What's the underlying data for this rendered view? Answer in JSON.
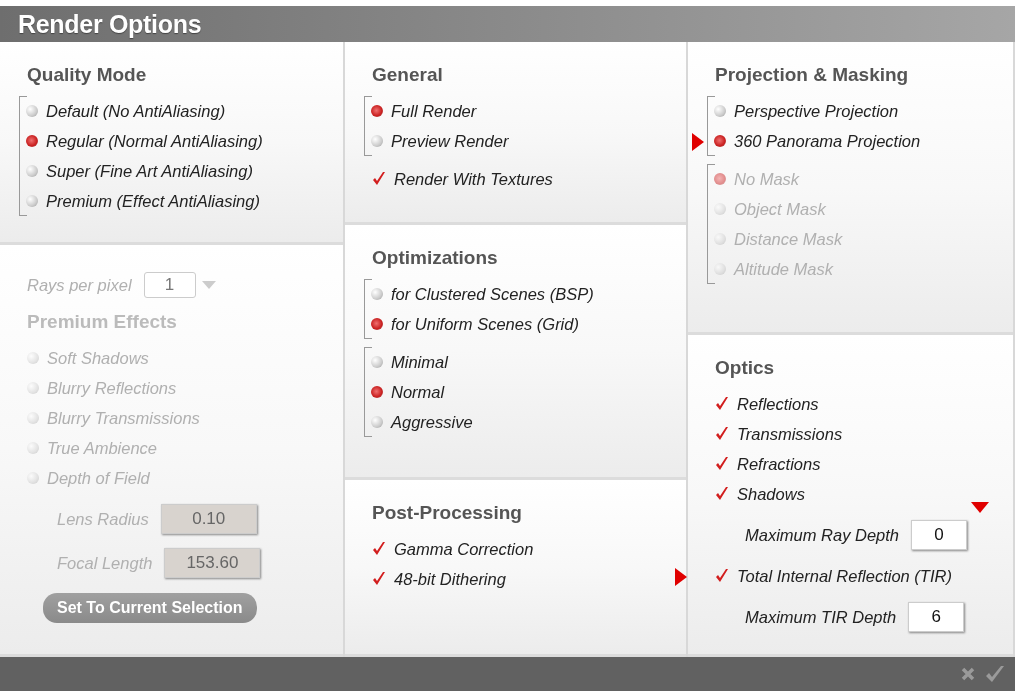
{
  "window": {
    "title": "Render Options"
  },
  "columns": [
    {
      "panels": [
        {
          "title": "Quality Mode",
          "blocks": [
            {
              "kind": "radio_group",
              "items": [
                {
                  "label": "Default (No AntiAliasing)",
                  "selected": false
                },
                {
                  "label": "Regular (Normal AntiAliasing)",
                  "selected": true
                },
                {
                  "label": "Super (Fine Art AntiAliasing)",
                  "selected": false
                },
                {
                  "label": "Premium (Effect AntiAliasing)",
                  "selected": false
                }
              ]
            }
          ]
        },
        {
          "disabled": true,
          "blocks": [
            {
              "kind": "dropdown",
              "label": "Rays per pixel",
              "value": "1"
            },
            {
              "kind": "heading",
              "label": "Premium Effects"
            },
            {
              "kind": "checks",
              "items": [
                {
                  "label": "Soft Shadows",
                  "checked": false
                },
                {
                  "label": "Blurry Reflections",
                  "checked": false
                },
                {
                  "label": "Blurry Transmissions",
                  "checked": false
                },
                {
                  "label": "True Ambience",
                  "checked": false
                },
                {
                  "label": "Depth of Field",
                  "checked": false
                }
              ]
            },
            {
              "kind": "field",
              "label": "Lens Radius",
              "value": "0.10"
            },
            {
              "kind": "field",
              "label": "Focal Length",
              "value": "153.60"
            },
            {
              "kind": "button",
              "label": "Set To Current Selection"
            }
          ]
        }
      ]
    },
    {
      "panels": [
        {
          "title": "General",
          "blocks": [
            {
              "kind": "radio_group",
              "items": [
                {
                  "label": "Full Render",
                  "selected": true
                },
                {
                  "label": "Preview Render",
                  "selected": false
                }
              ]
            },
            {
              "kind": "checks",
              "items": [
                {
                  "label": "Render With Textures",
                  "checked": true
                }
              ]
            }
          ]
        },
        {
          "title": "Optimizations",
          "blocks": [
            {
              "kind": "radio_group",
              "items": [
                {
                  "label": "for Clustered Scenes (BSP)",
                  "selected": false
                },
                {
                  "label": "for Uniform Scenes (Grid)",
                  "selected": true
                }
              ]
            },
            {
              "kind": "radio_group",
              "items": [
                {
                  "label": "Minimal",
                  "selected": false
                },
                {
                  "label": "Normal",
                  "selected": true
                },
                {
                  "label": "Aggressive",
                  "selected": false
                }
              ]
            }
          ]
        },
        {
          "title": "Post-Processing",
          "blocks": [
            {
              "kind": "checks",
              "items": [
                {
                  "label": "Gamma Correction",
                  "checked": true
                },
                {
                  "label": "48-bit Dithering",
                  "checked": true
                }
              ]
            }
          ]
        }
      ]
    },
    {
      "panels": [
        {
          "title": "Projection & Masking",
          "blocks": [
            {
              "kind": "radio_group",
              "items": [
                {
                  "label": "Perspective Projection",
                  "selected": false
                },
                {
                  "label": "360  Panorama Projection",
                  "selected": true,
                  "marked": true
                }
              ]
            },
            {
              "kind": "radio_group",
              "disabled": true,
              "items": [
                {
                  "label": "No Mask",
                  "selected": true
                },
                {
                  "label": "Object Mask",
                  "selected": false
                },
                {
                  "label": "Distance Mask",
                  "selected": false
                },
                {
                  "label": "Altitude Mask",
                  "selected": false
                }
              ]
            }
          ]
        },
        {
          "title": "Optics",
          "blocks": [
            {
              "kind": "checks",
              "items": [
                {
                  "label": "Reflections",
                  "checked": true
                },
                {
                  "label": "Transmissions",
                  "checked": true
                },
                {
                  "label": "Refractions",
                  "checked": true
                },
                {
                  "label": "Shadows",
                  "checked": true
                }
              ]
            },
            {
              "kind": "field",
              "label": "Maximum Ray Depth",
              "value": "0",
              "marked": true
            },
            {
              "kind": "checks",
              "items": [
                {
                  "label": "Total Internal Reflection (TIR)",
                  "checked": true,
                  "marked": true
                }
              ]
            },
            {
              "kind": "field",
              "label": "Maximum TIR Depth",
              "value": "6"
            }
          ]
        }
      ]
    }
  ]
}
